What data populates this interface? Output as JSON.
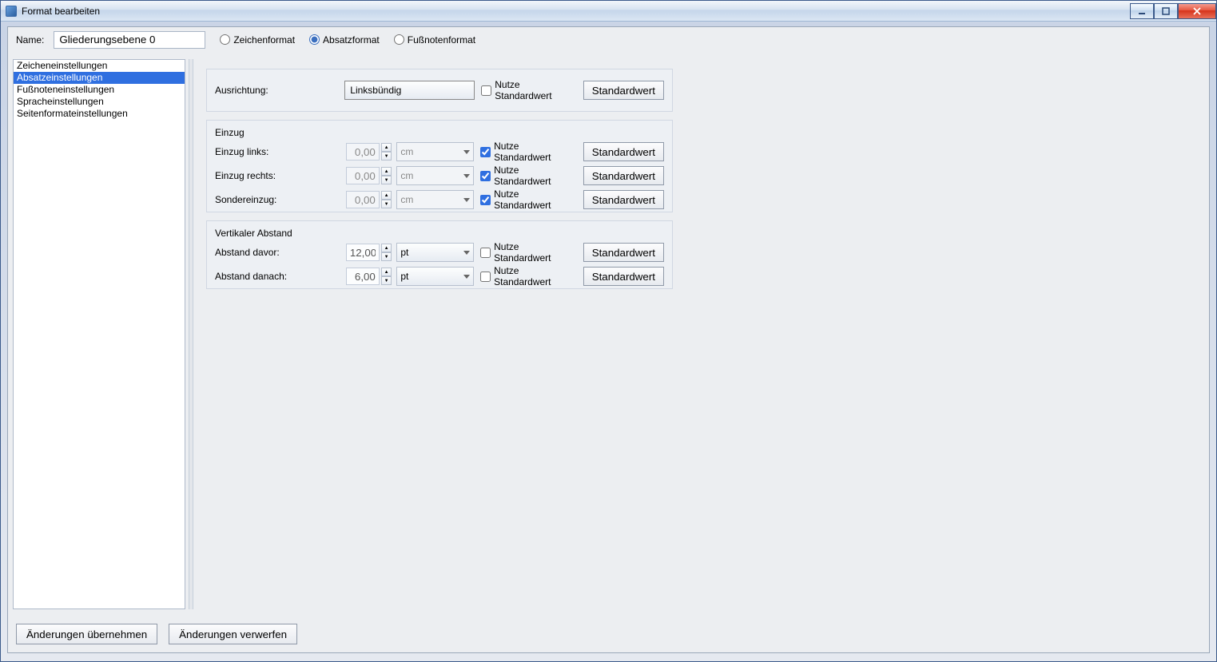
{
  "window": {
    "title": "Format bearbeiten"
  },
  "top": {
    "name_label": "Name:",
    "name_value": "Gliederungsebene 0",
    "radios": {
      "char": "Zeichenformat",
      "para": "Absatzformat",
      "foot": "Fußnotenformat"
    }
  },
  "sidebar": {
    "items": [
      "Zeicheneinstellungen",
      "Absatzeinstellungen",
      "Fußnoteneinstellungen",
      "Spracheinstellungen",
      "Seitenformateinstellungen"
    ],
    "selected_index": 1
  },
  "panel": {
    "alignment": {
      "label": "Ausrichtung:",
      "value": "Linksbündig",
      "use_std_label": "Nutze Standardwert",
      "use_std": false,
      "std_btn": "Standardwert"
    },
    "indent": {
      "heading": "Einzug",
      "rows": [
        {
          "label": "Einzug links:",
          "value": "0,00",
          "unit": "cm",
          "use_std": true,
          "disabled": true
        },
        {
          "label": "Einzug rechts:",
          "value": "0,00",
          "unit": "cm",
          "use_std": true,
          "disabled": true
        },
        {
          "label": "Sondereinzug:",
          "value": "0,00",
          "unit": "cm",
          "use_std": true,
          "disabled": true
        }
      ],
      "use_std_label": "Nutze Standardwert",
      "std_btn": "Standardwert"
    },
    "vspace": {
      "heading": "Vertikaler Abstand",
      "rows": [
        {
          "label": "Abstand davor:",
          "value": "12,00",
          "unit": "pt",
          "use_std": false,
          "disabled": false
        },
        {
          "label": "Abstand danach:",
          "value": "6,00",
          "unit": "pt",
          "use_std": false,
          "disabled": false
        }
      ],
      "use_std_label": "Nutze Standardwert",
      "std_btn": "Standardwert"
    }
  },
  "bottom": {
    "apply": "Änderungen übernehmen",
    "discard": "Änderungen verwerfen"
  }
}
